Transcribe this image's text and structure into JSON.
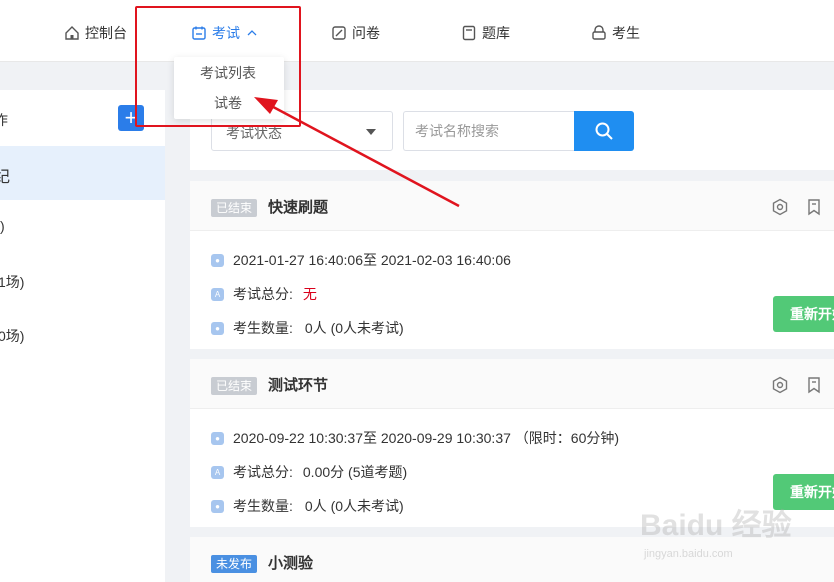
{
  "nav": {
    "items": [
      {
        "label": "控制台",
        "icon": "home-icon"
      },
      {
        "label": "考试",
        "icon": "calendar-icon"
      },
      {
        "label": "问卷",
        "icon": "edit-icon"
      },
      {
        "label": "题库",
        "icon": "book-icon"
      },
      {
        "label": "考生",
        "icon": "user-icon"
      }
    ],
    "dropdown": [
      "考试列表",
      "试卷"
    ]
  },
  "sidebar": {
    "header_partial": "作",
    "active_partial": "纪",
    "item1_partial": ")",
    "item2_partial": "1场)",
    "item3_partial": "0场)",
    "plus": "+"
  },
  "filter": {
    "status_select": "考试状态",
    "search_placeholder": "考试名称搜索"
  },
  "cards": [
    {
      "badge": "已结束",
      "title": "快速刷题",
      "time": "2021-01-27 16:40:06至 2021-02-03 16:40:06",
      "score_label": "考试总分:",
      "score_value": "无",
      "count_label": "考生数量:",
      "count_value": "0人 (0人未考试)",
      "action": "重新开始"
    },
    {
      "badge": "已结束",
      "title": "测试环节",
      "time": "2020-09-22 10:30:37至 2020-09-29 10:30:37 （限时：60分钟)",
      "score_label": "考试总分:",
      "score_value": "0.00分 (5道考题)",
      "count_label": "考生数量:",
      "count_value": "0人 (0人未考试)",
      "action": "重新开始"
    },
    {
      "badge": "未发布",
      "title": "小测验"
    }
  ],
  "watermark": {
    "brand": "Baidu 经验",
    "url": "jingyan.baidu.com"
  },
  "colors": {
    "accent": "#2b7de9",
    "annotation": "#e0141e",
    "success": "#52c977",
    "danger": "#d9001b"
  }
}
